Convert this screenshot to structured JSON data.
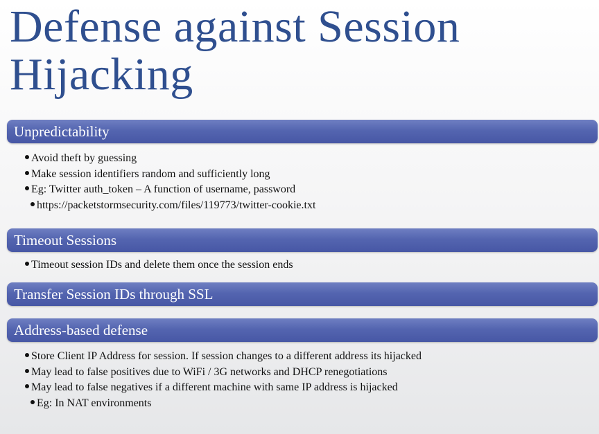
{
  "title_line1": "Defense against Session",
  "title_line2": "Hijacking",
  "sections": [
    {
      "heading": "Unpredictability",
      "bullets": [
        {
          "level": 1,
          "text": "Avoid theft by guessing"
        },
        {
          "level": 1,
          "text": "Make session identifiers random and sufficiently long"
        },
        {
          "level": 1,
          "text": "Eg: Twitter auth_token – A function of username, password"
        },
        {
          "level": 2,
          "text": "https://packetstormsecurity.com/files/119773/twitter-cookie.txt"
        }
      ]
    },
    {
      "heading": "Timeout Sessions",
      "bullets": [
        {
          "level": 1,
          "text": "Timeout session IDs and delete them once the session ends"
        }
      ]
    },
    {
      "heading": "Transfer Session IDs through SSL",
      "bullets": []
    },
    {
      "heading": "Address-based defense",
      "bullets": [
        {
          "level": 1,
          "text": "Store Client IP Address for session. If session changes to a different address its hijacked"
        },
        {
          "level": 1,
          "text": "May lead to false positives due to WiFi / 3G networks and DHCP renegotiations"
        },
        {
          "level": 1,
          "text": "May lead to false negatives if a different machine with same IP address is hijacked"
        },
        {
          "level": 2,
          "text": "Eg: In NAT environments"
        }
      ]
    }
  ]
}
